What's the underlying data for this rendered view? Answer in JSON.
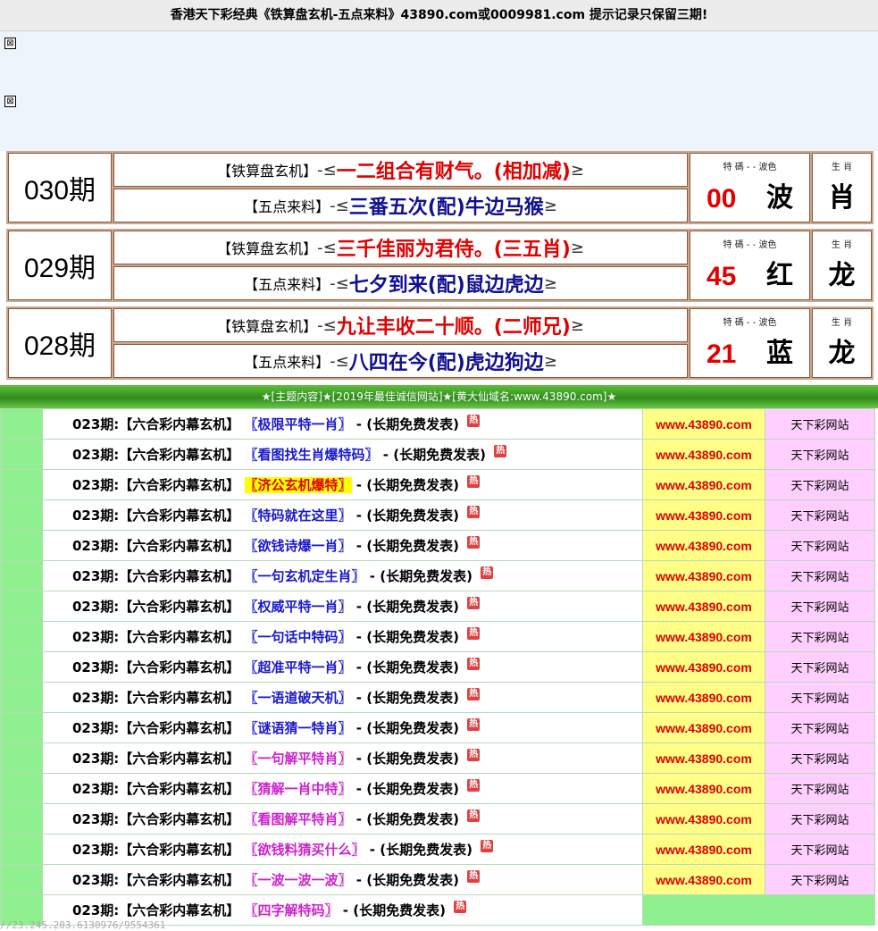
{
  "header": {
    "title": "香港天下彩经典《铁算盘玄机-五点来料》43890.com或0009981.com   提示记录只保留三期!"
  },
  "broken_image_glyph": "⊠",
  "periods": [
    {
      "label": "030期",
      "line1_prefix": "【铁算盘玄机】",
      "line1_text": "一二组合有财气。(相加减)",
      "line2_prefix": "【五点来料】",
      "line2_text": "三番五次(配)牛边马猴",
      "caption_num": "特 碼 - - 波色",
      "number": "00",
      "wave": "波",
      "caption_zodiac": "生 肖",
      "zodiac": "肖",
      "wave_color": "#000000"
    },
    {
      "label": "029期",
      "line1_prefix": "【铁算盘玄机】",
      "line1_text": "三千佳丽为君侍。(三五肖)",
      "line2_prefix": "【五点来料】",
      "line2_text": "七夕到来(配)鼠边虎边",
      "caption_num": "特 碼 - - 波色",
      "number": "45",
      "wave": "红",
      "caption_zodiac": "生 肖",
      "zodiac": "龙",
      "wave_color": "#000000"
    },
    {
      "label": "028期",
      "line1_prefix": "【铁算盘玄机】",
      "line1_text": "九让丰收二十顺。(二师兄)",
      "line2_prefix": "【五点来料】",
      "line2_text": "八四在今(配)虎边狗边",
      "caption_num": "特 碼 - - 波色",
      "number": "21",
      "wave": "蓝",
      "caption_zodiac": "生 肖",
      "zodiac": "龙",
      "wave_color": "#000000"
    }
  ],
  "dash": "-",
  "lt": "≤",
  "gt": "≥",
  "banner": "★[主题内容]★[2019年最佳诚信网站]★[黄大仙域名:www.43890.com]★",
  "rows": [
    {
      "prefix": "023期:【六合彩内幕玄机】",
      "link": "〖极限平特一肖〗",
      "style": "blue",
      "suffix": "- (长期免费发表)",
      "hot": "热",
      "site": "www.43890.com",
      "name": "天下彩网站"
    },
    {
      "prefix": "023期:【六合彩内幕玄机】",
      "link": "〖看图找生肖爆特码〗",
      "style": "blue",
      "suffix": "- (长期免费发表)",
      "hot": "热",
      "site": "www.43890.com",
      "name": "天下彩网站"
    },
    {
      "prefix": "023期:【六合彩内幕玄机】",
      "link": "〖济公玄机爆特〗",
      "style": "hl",
      "suffix": "- (长期免费发表)",
      "hot": "热",
      "site": "www.43890.com",
      "name": "天下彩网站"
    },
    {
      "prefix": "023期:【六合彩内幕玄机】",
      "link": "〖特码就在这里〗",
      "style": "blue",
      "suffix": "- (长期免费发表)",
      "hot": "热",
      "site": "www.43890.com",
      "name": "天下彩网站"
    },
    {
      "prefix": "023期:【六合彩内幕玄机】",
      "link": "〖欲钱诗爆一肖〗",
      "style": "blue",
      "suffix": "- (长期免费发表)",
      "hot": "热",
      "site": "www.43890.com",
      "name": "天下彩网站"
    },
    {
      "prefix": "023期:【六合彩内幕玄机】",
      "link": "〖一句玄机定生肖〗",
      "style": "blue",
      "suffix": "- (长期免费发表)",
      "hot": "热",
      "site": "www.43890.com",
      "name": "天下彩网站"
    },
    {
      "prefix": "023期:【六合彩内幕玄机】",
      "link": "〖权威平特一肖〗",
      "style": "blue",
      "suffix": "- (长期免费发表)",
      "hot": "热",
      "site": "www.43890.com",
      "name": "天下彩网站"
    },
    {
      "prefix": "023期:【六合彩内幕玄机】",
      "link": "〖一句话中特码〗",
      "style": "blue",
      "suffix": "- (长期免费发表)",
      "hot": "热",
      "site": "www.43890.com",
      "name": "天下彩网站"
    },
    {
      "prefix": "023期:【六合彩内幕玄机】",
      "link": "〖超准平特一肖〗",
      "style": "blue",
      "suffix": "- (长期免费发表)",
      "hot": "热",
      "site": "www.43890.com",
      "name": "天下彩网站"
    },
    {
      "prefix": "023期:【六合彩内幕玄机】",
      "link": "〖一语道破天机〗",
      "style": "blue",
      "suffix": "- (长期免费发表)",
      "hot": "热",
      "site": "www.43890.com",
      "name": "天下彩网站"
    },
    {
      "prefix": "023期:【六合彩内幕玄机】",
      "link": "〖谜语猜一特肖〗",
      "style": "blue",
      "suffix": "- (长期免费发表)",
      "hot": "热",
      "site": "www.43890.com",
      "name": "天下彩网站"
    },
    {
      "prefix": "023期:【六合彩内幕玄机】",
      "link": "〖一句解平特肖〗",
      "style": "mag",
      "suffix": "- (长期免费发表)",
      "hot": "热",
      "site": "www.43890.com",
      "name": "天下彩网站"
    },
    {
      "prefix": "023期:【六合彩内幕玄机】",
      "link": "〖猜解一肖中特〗",
      "style": "mag",
      "suffix": "- (长期免费发表)",
      "hot": "热",
      "site": "www.43890.com",
      "name": "天下彩网站"
    },
    {
      "prefix": "023期:【六合彩内幕玄机】",
      "link": "〖看图解平特肖〗",
      "style": "mag",
      "suffix": "- (长期免费发表)",
      "hot": "热",
      "site": "www.43890.com",
      "name": "天下彩网站"
    },
    {
      "prefix": "023期:【六合彩内幕玄机】",
      "link": "〖欲钱料猜买什么〗",
      "style": "mag",
      "suffix": "- (长期免费发表)",
      "hot": "热",
      "site": "www.43890.com",
      "name": "天下彩网站"
    },
    {
      "prefix": "023期:【六合彩内幕玄机】",
      "link": "〖一波一波一波〗",
      "style": "mag",
      "suffix": "- (长期免费发表)",
      "hot": "热",
      "site": "www.43890.com",
      "name": "天下彩网站"
    },
    {
      "prefix": "023期:【六合彩内幕玄机】",
      "link": "〖四字解特码〗",
      "style": "mag",
      "suffix": "- (长期免费发表)",
      "hot": "热",
      "site": "",
      "name": ""
    }
  ],
  "ip_stamp": "//23.245.203.6130976/9554361"
}
